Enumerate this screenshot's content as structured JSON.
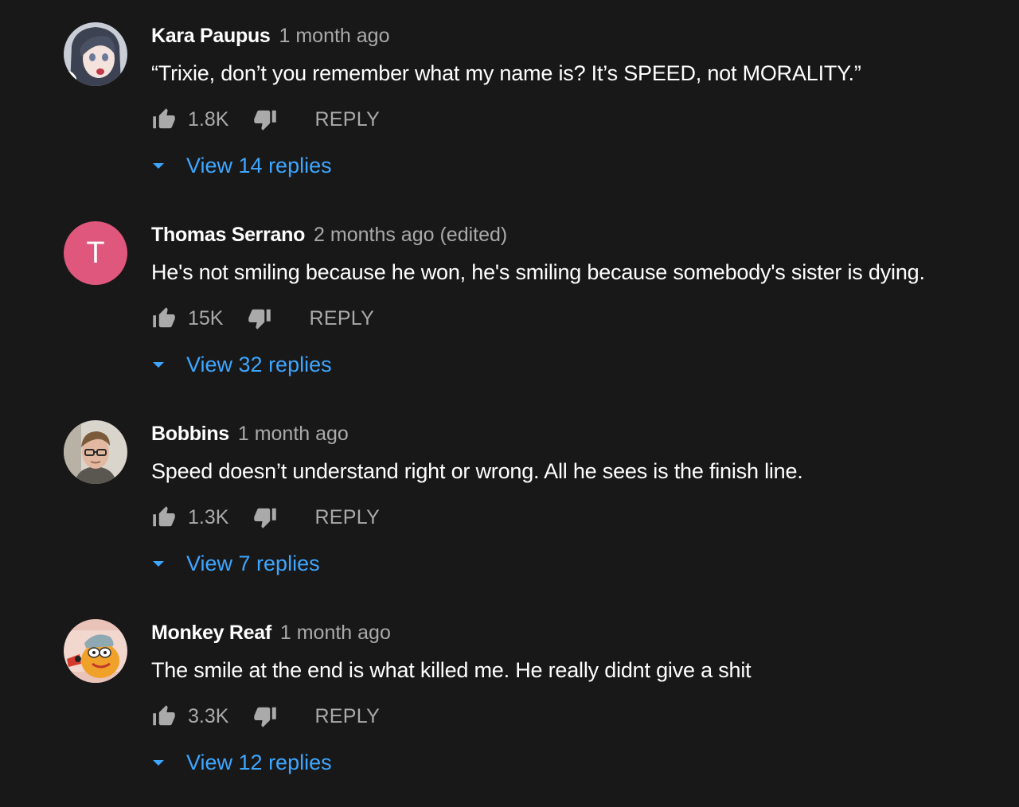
{
  "comments": [
    {
      "author": "Kara Paupus",
      "time": "1 month ago",
      "text": "“Trixie, don’t you remember what my name is? It’s SPEED, not MORALITY.”",
      "likes": "1.8K",
      "reply_label": "REPLY",
      "view_replies": "View 14 replies",
      "avatar_icon": "anime-girl-avatar"
    },
    {
      "author": "Thomas Serrano",
      "time": "2 months ago (edited)",
      "text": "He's not smiling because he won, he's smiling because somebody's sister is dying.",
      "likes": "15K",
      "reply_label": "REPLY",
      "view_replies": "View 32 replies",
      "avatar_letter": "T",
      "avatar_color": "#e0577d"
    },
    {
      "author": "Bobbins",
      "time": "1 month ago",
      "text": "Speed doesn’t understand right or wrong. All he sees is the finish line.",
      "likes": "1.3K",
      "reply_label": "REPLY",
      "view_replies": "View 7 replies",
      "avatar_icon": "person-with-glasses-avatar"
    },
    {
      "author": "Monkey Reaf",
      "time": "1 month ago",
      "text": "The smile at the end is what killed me. He really didnt give a shit",
      "likes": "3.3K",
      "reply_label": "REPLY",
      "view_replies": "View 12 replies",
      "avatar_icon": "cartoon-bird-avatar"
    }
  ],
  "colors": {
    "background": "#181818",
    "link": "#3ea6ff",
    "secondary_text": "#aaaaaa",
    "primary_text": "#ffffff"
  }
}
